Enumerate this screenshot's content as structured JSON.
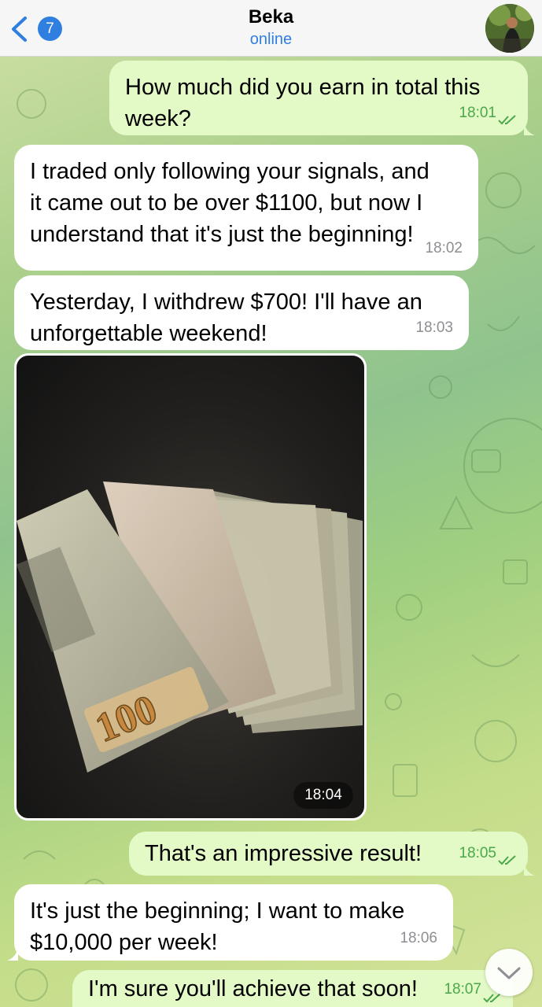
{
  "header": {
    "back_badge": "7",
    "contact_name": "Beka",
    "status": "online"
  },
  "messages": [
    {
      "direction": "out",
      "text_lines": [
        "How much did you earn in total this",
        "week?"
      ],
      "time": "18:01",
      "read": true
    },
    {
      "direction": "in",
      "text_lines": [
        "I traded only following your signals, and",
        "it came out to be over $1100, but now I",
        "understand that it's just the beginning!"
      ],
      "time": "18:02"
    },
    {
      "direction": "in",
      "text_lines": [
        "Yesterday, I withdrew $700! I'll have an",
        "unforgettable weekend!"
      ],
      "time": "18:03"
    },
    {
      "direction": "in",
      "type": "photo",
      "photo_caption_on_bill": "100",
      "time": "18:04"
    },
    {
      "direction": "out",
      "text_lines": [
        "That's an impressive result!"
      ],
      "time": "18:05",
      "read": true
    },
    {
      "direction": "in",
      "text_lines": [
        "It's just the beginning; I want to make",
        "$10,000 per week!"
      ],
      "time": "18:06"
    },
    {
      "direction": "out",
      "text_lines": [
        "I'm sure you'll achieve that soon!"
      ],
      "time": "18:07",
      "read": true
    }
  ],
  "icons": {
    "back": "chevron-left-icon",
    "read": "double-check-icon",
    "scroll": "chevron-down-icon"
  },
  "colors": {
    "accent": "#2f7fe0",
    "incoming_bubble": "#ffffff",
    "outgoing_bubble": "#e3f9c6",
    "outgoing_time": "#4aa84a"
  }
}
